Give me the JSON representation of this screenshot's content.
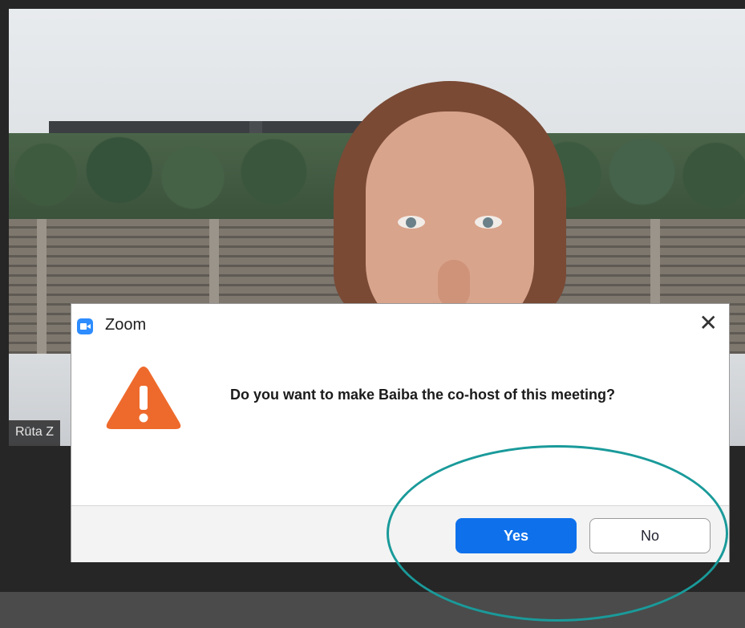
{
  "video": {
    "participant_name": "Rūta Z"
  },
  "dialog": {
    "app_icon": "zoom-app-icon",
    "title": "Zoom",
    "close_symbol": "✕",
    "warning_icon": "warning-triangle-icon",
    "warning_color": "#ee6a2c",
    "message": "Do you want to make Baiba the co-host of this meeting?",
    "buttons": {
      "yes": "Yes",
      "no": "No"
    }
  },
  "colors": {
    "accent": "#0e71eb",
    "annotation": "#1a9a9a"
  }
}
